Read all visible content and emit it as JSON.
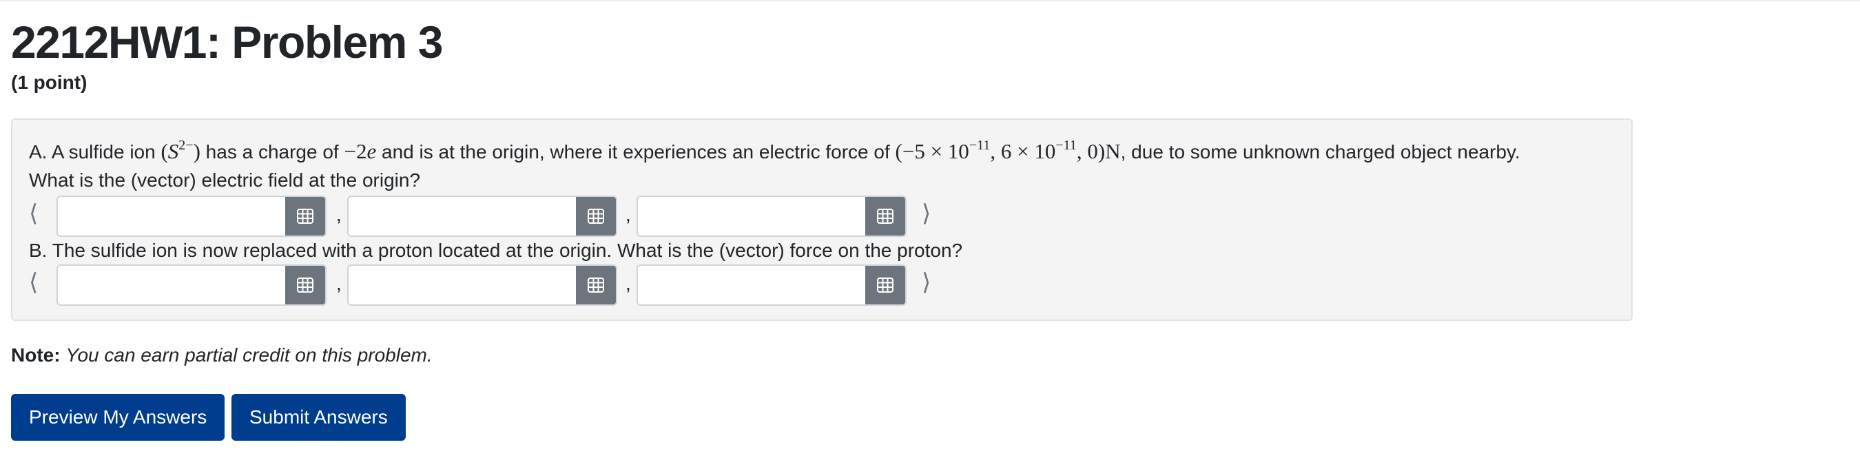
{
  "problem": {
    "title": "2212HW1: Problem 3",
    "points": "(1 point)"
  },
  "part_a": {
    "text_1": "A. A sulfide ion ",
    "ion_symbol": "S",
    "ion_charge": "2−",
    "text_2": " has a charge of ",
    "charge_value": "−2",
    "charge_symbol": "e",
    "text_3": " and is at the origin, where it experiences an electric force of ",
    "force_x_mantissa": "−5 × 10",
    "force_exponent": "−11",
    "force_y_mantissa": "6 × 10",
    "force_z": "0",
    "force_unit": "N",
    "text_4": ", due to some unknown charged object nearby.",
    "question": "What is the (vector) electric field at the origin?"
  },
  "part_b": {
    "question": "B. The sulfide ion is now replaced with a proton located at the origin. What is the (vector) force on the proton?"
  },
  "vector": {
    "open": "⟨",
    "close": "⟩",
    "separator": ","
  },
  "answer_inputs": {
    "a_x": "",
    "a_y": "",
    "a_z": "",
    "b_x": "",
    "b_y": "",
    "b_z": ""
  },
  "equation_editor_icon": "grid-icon",
  "note": {
    "label": "Note:",
    "text": "You can earn partial credit on this problem."
  },
  "buttons": {
    "preview": "Preview My Answers",
    "submit": "Submit Answers"
  },
  "colors": {
    "primary_button": "#003d8f",
    "equation_button": "#6c757d",
    "panel_background": "#f4f4f4"
  }
}
